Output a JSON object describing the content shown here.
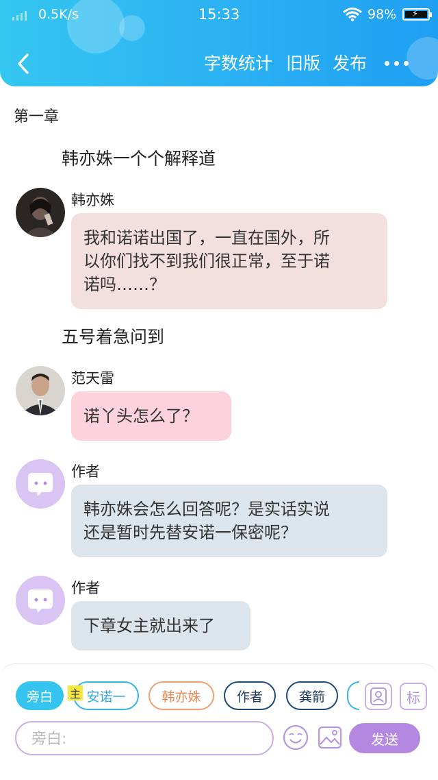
{
  "status_bar": {
    "speed": "0.5K/s",
    "time": "15:33",
    "battery": "98%"
  },
  "toolbar": {
    "word_count": "字数统计",
    "old_version": "旧版",
    "publish": "发布"
  },
  "colors": {
    "header_gradient_start": "#35c6f0",
    "header_gradient_end": "#1f9ff2",
    "bubble_hanyishu": "#f3dfdd",
    "bubble_fantianlei": "#fcd3dd",
    "bubble_author": "#dde5ec",
    "accent_purple": "#b487e0"
  },
  "content": {
    "chapter_title": "第一章",
    "narrations": [
      "韩亦姝一个个解释道",
      "五号着急问到"
    ],
    "messages": [
      {
        "speaker": "韩亦姝",
        "avatar": "photo-woman",
        "lines": [
          "我和诺诺出国了，一直在国外，所",
          "以你们找不到我们很正常，至于诺",
          "诺吗……？"
        ]
      },
      {
        "speaker": "范天雷",
        "avatar": "photo-man-suit",
        "lines": [
          "诺丫头怎么了？"
        ]
      },
      {
        "speaker": "作者",
        "avatar": "chat-bubble-icon",
        "lines": [
          "韩亦姝会怎么回答呢？是实话实说",
          "还是暂时先替安诺一保密呢？"
        ]
      },
      {
        "speaker": "作者",
        "avatar": "chat-bubble-icon",
        "lines": [
          "下章女主就出来了"
        ]
      }
    ]
  },
  "roles": {
    "narration": "旁白",
    "main_tag": "主",
    "items": [
      "安诺一",
      "韩亦姝",
      "作者",
      "龚箭"
    ]
  },
  "tools": {
    "role_icon": "user-card-icon",
    "tag_label": "标"
  },
  "input": {
    "placeholder": "旁白:",
    "value": ""
  },
  "send_label": "发送"
}
